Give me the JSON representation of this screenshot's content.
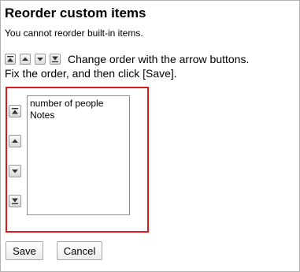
{
  "heading": "Reorder custom items",
  "note": "You cannot reorder built-in items.",
  "instructions": {
    "line1": "Change order with the arrow buttons.",
    "line2": "Fix the order, and then click [Save]."
  },
  "legend_icons": [
    "move-to-top-icon",
    "move-up-icon",
    "move-down-icon",
    "move-to-bottom-icon"
  ],
  "side_controls": [
    "move-to-top-icon",
    "move-up-icon",
    "move-down-icon",
    "move-to-bottom-icon"
  ],
  "items": [
    {
      "label": "number of people"
    },
    {
      "label": "Notes"
    }
  ],
  "highlight_color": "#e01818",
  "buttons": {
    "save": "Save",
    "cancel": "Cancel"
  }
}
